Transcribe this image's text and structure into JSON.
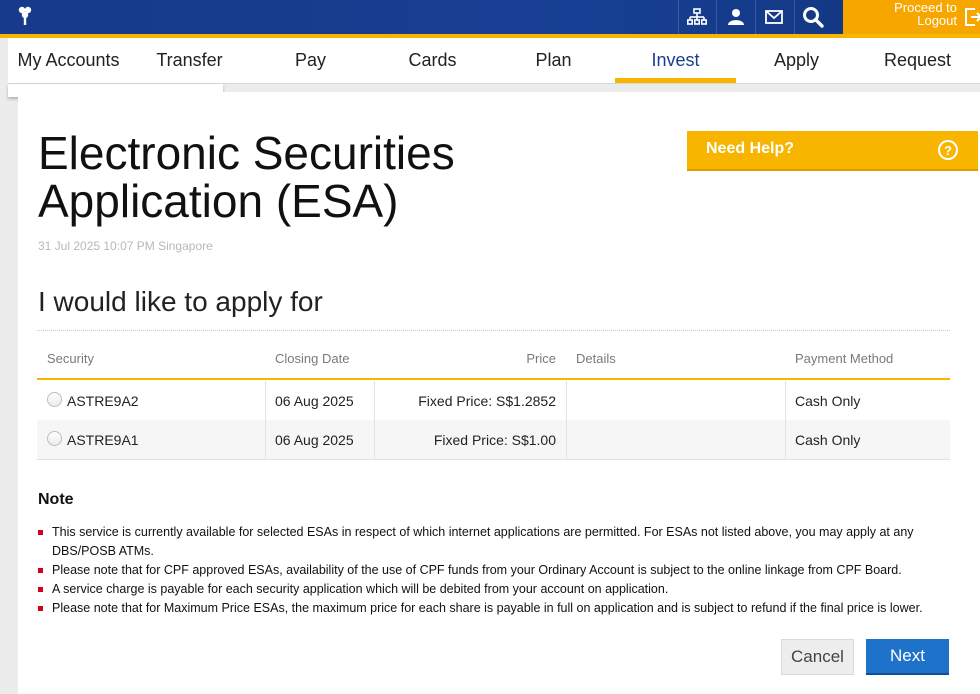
{
  "topbar": {
    "icons": [
      "sitemap-icon",
      "user-icon",
      "mail-icon",
      "search-icon"
    ],
    "logout_label_line1": "Proceed to",
    "logout_label_line2": "Logout"
  },
  "nav": {
    "tabs": [
      {
        "label": "My Accounts"
      },
      {
        "label": "Transfer"
      },
      {
        "label": "Pay"
      },
      {
        "label": "Cards"
      },
      {
        "label": "Plan"
      },
      {
        "label": "Invest",
        "active": true
      },
      {
        "label": "Apply"
      },
      {
        "label": "Request"
      }
    ]
  },
  "page": {
    "title_line1": "Electronic Securities",
    "title_line2": "Application (ESA)",
    "timestamp": "31 Jul 2025 10:07 PM Singapore",
    "help_label": "Need Help?",
    "help_icon": "?",
    "subtitle": "I would like to apply for"
  },
  "table": {
    "headers": {
      "security": "Security",
      "closing_date": "Closing Date",
      "price": "Price",
      "details": "Details",
      "payment_method": "Payment Method"
    },
    "rows": [
      {
        "security": "ASTRE9A2",
        "closing_date": "06 Aug 2025",
        "price": "Fixed Price: S$1.2852",
        "details": "",
        "payment_method": "Cash Only"
      },
      {
        "security": "ASTRE9A1",
        "closing_date": "06 Aug 2025",
        "price": "Fixed Price: S$1.00",
        "details": "",
        "payment_method": "Cash Only"
      }
    ]
  },
  "notes": {
    "heading": "Note",
    "items": [
      "This service is currently available for selected ESAs in respect of which internet applications are permitted. For ESAs not listed above, you may apply at any DBS/POSB ATMs.",
      "Please note that for CPF approved ESAs, availability of the use of CPF funds from your Ordinary Account is subject to the online linkage from CPF Board.",
      "A service charge is payable for each security application which will be debited from your account on application.",
      "Please note that for Maximum Price ESAs, the maximum price for each share is payable in full on application and is subject to refund if the final price is lower."
    ]
  },
  "actions": {
    "cancel_label": "Cancel",
    "next_label": "Next"
  },
  "colors": {
    "brand_blue": "#173f93",
    "accent_yellow": "#f7b500",
    "button_blue": "#1f72c9",
    "bullet_red": "#d0021b"
  }
}
